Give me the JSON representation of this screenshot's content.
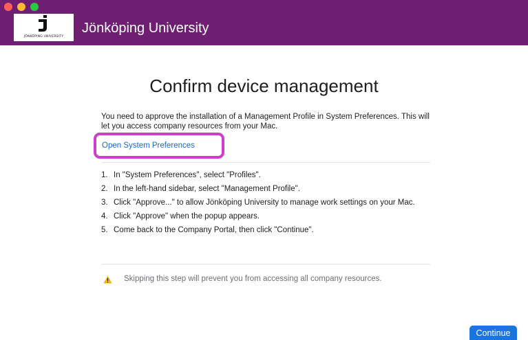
{
  "window": {
    "controls": [
      "close-button",
      "minimize-button",
      "zoom-button"
    ]
  },
  "header": {
    "logo_text": "JÖNKÖPING UNIVERSITY",
    "app_title": "Jönköping University",
    "background": "#6e1f72"
  },
  "main": {
    "title": "Confirm device management",
    "intro": "You need to approve the installation of a Management Profile in System Preferences. This will let you access company resources from your Mac.",
    "open_prefs_link": "Open System Preferences",
    "steps": [
      {
        "num": "1.",
        "text": "In \"System Preferences\", select \"Profiles\"."
      },
      {
        "num": "2.",
        "text": "In the left-hand sidebar, select \"Management Profile\"."
      },
      {
        "num": "3.",
        "text": "Click \"Approve...\" to allow Jönköping University to manage work settings on your Mac."
      },
      {
        "num": "4.",
        "text": "Click \"Approve\" when the popup appears."
      },
      {
        "num": "5.",
        "text": "Come back to the Company Portal, then click \"Continue\"."
      }
    ],
    "warning": "Skipping this step will prevent you from accessing all company resources.",
    "warning_icon": "warning-icon"
  },
  "footer": {
    "continue_label": "Continue",
    "accent": "#1a75e3"
  },
  "highlight": {
    "color": "#cc3fc9"
  }
}
